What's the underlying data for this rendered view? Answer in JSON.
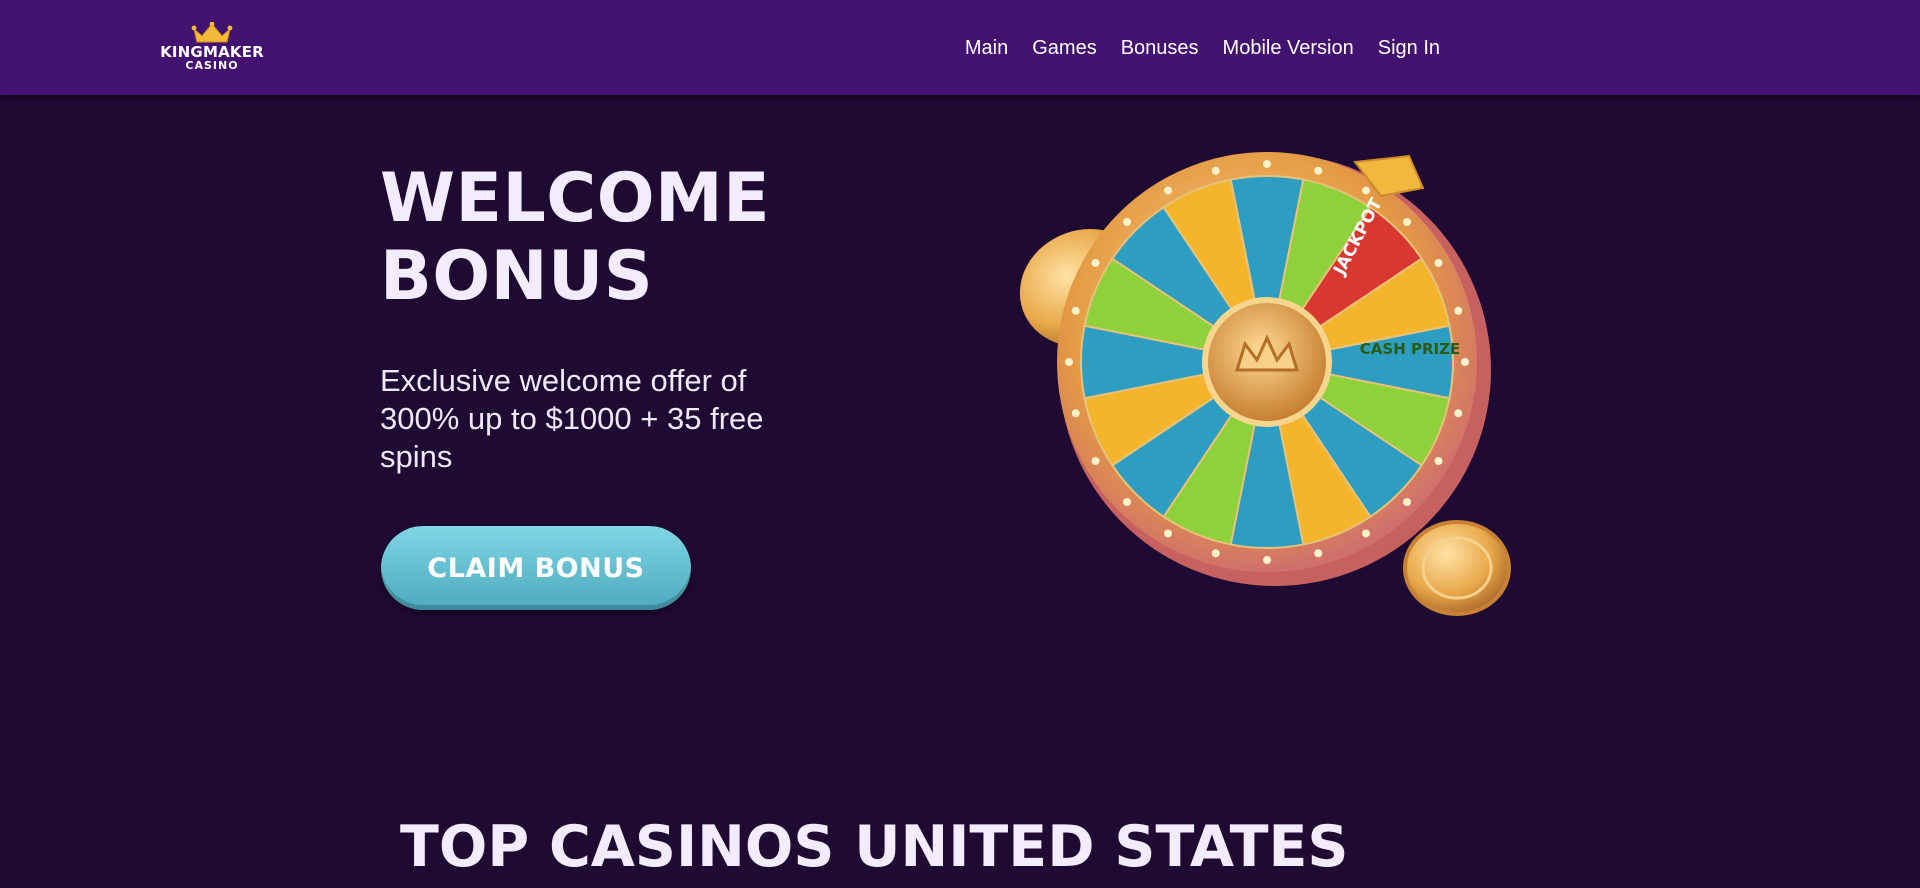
{
  "header": {
    "logo": {
      "line1": "KINGMAKER",
      "line2": "CASINO"
    },
    "nav": [
      "Main",
      "Games",
      "Bonuses",
      "Mobile Version",
      "Sign In"
    ]
  },
  "hero": {
    "title_line1": "WELCOME",
    "title_line2": "BONUS",
    "subtitle": "Exclusive welcome offer of 300% up to $1000 + 35 free spins",
    "cta_label": "CLAIM BONUS",
    "wheel": {
      "labels": [
        "JACKPOT",
        "CASH PRIZE"
      ]
    }
  },
  "section": {
    "title": "TOP CASINOS UNITED STATES"
  },
  "colors": {
    "header_bg": "#431270",
    "page_bg": "#1f0a33",
    "cta": "#6cc4d4",
    "wheel_blue": "#2d9dc2",
    "wheel_yellow": "#f4b52c",
    "jackpot_red": "#d8382f",
    "gold": "#e8a94a"
  }
}
